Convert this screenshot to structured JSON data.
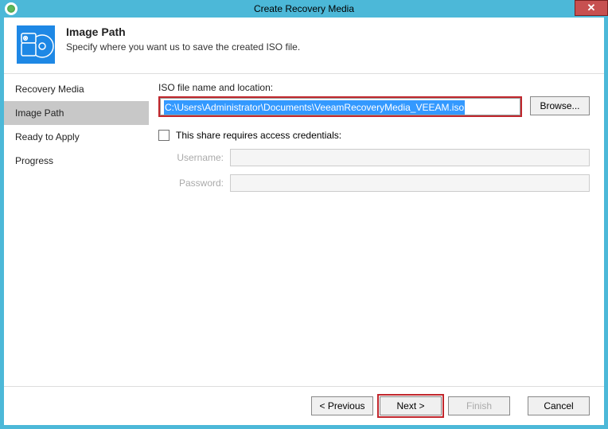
{
  "window": {
    "title": "Create Recovery Media"
  },
  "header": {
    "title": "Image Path",
    "subtitle": "Specify where you want us to save the created ISO file."
  },
  "sidebar": {
    "items": [
      {
        "label": "Recovery Media",
        "active": false
      },
      {
        "label": "Image Path",
        "active": true
      },
      {
        "label": "Ready to Apply",
        "active": false
      },
      {
        "label": "Progress",
        "active": false
      }
    ]
  },
  "content": {
    "path_label": "ISO file name and location:",
    "path_value": "C:\\Users\\Administrator\\Documents\\VeeamRecoveryMedia_VEEAM.iso",
    "browse_label": "Browse...",
    "share_checkbox_label": "This share requires access credentials:",
    "share_checked": false,
    "username_label": "Username:",
    "username_value": "",
    "password_label": "Password:",
    "password_value": ""
  },
  "footer": {
    "previous": "< Previous",
    "next": "Next >",
    "finish": "Finish",
    "cancel": "Cancel"
  }
}
